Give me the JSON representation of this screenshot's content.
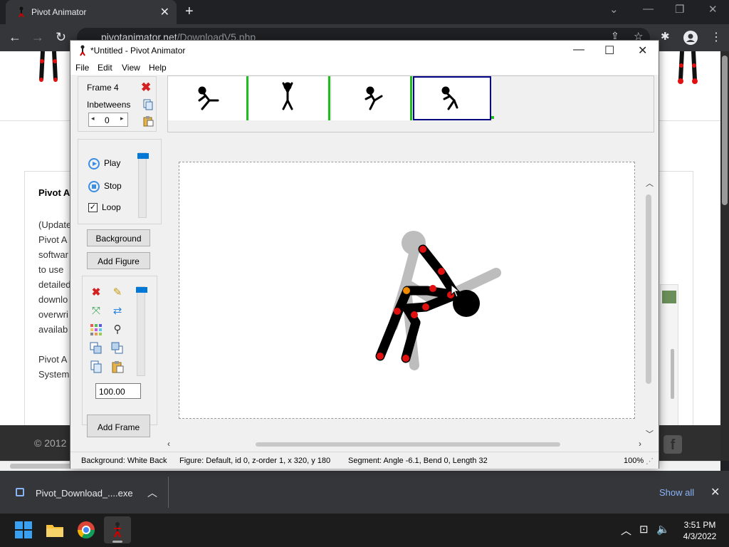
{
  "browser": {
    "tab_title": "Pivot Animator",
    "url_host": "pivotanimator.net",
    "url_path": "/DownloadV5.php",
    "icons": [
      "back-icon",
      "forward-icon",
      "reload-icon",
      "lock-icon",
      "share-icon",
      "star-icon",
      "extensions-icon",
      "profile-icon",
      "menu-icon"
    ]
  },
  "webpage": {
    "heading": "Pivot A",
    "lines": [
      "(Update",
      "Pivot A",
      "softwar",
      "to use",
      "detailed",
      "downlo",
      "overwri",
      "availab"
    ],
    "lines2": [
      "Pivot A",
      "System"
    ],
    "footer": "© 2012"
  },
  "downloads": {
    "file_name": "Pivot_Download_....exe",
    "show_all": "Show all"
  },
  "taskbar": {
    "time": "3:51 PM",
    "date": "4/3/2022"
  },
  "pivot": {
    "title": "*Untitled - Pivot Animator",
    "menu": [
      "File",
      "Edit",
      "View",
      "Help"
    ],
    "frame_label": "Frame 4",
    "inbetweens_label": "Inbetweens",
    "inbetweens_value": "0",
    "play_label": "Play",
    "stop_label": "Stop",
    "loop_label": "Loop",
    "background_button": "Background",
    "add_figure_button": "Add Figure",
    "zoom_value": "100.00",
    "add_frame_button": "Add Frame",
    "status": {
      "background": "Background: White Back",
      "figure": "Figure: Default,  id 0,  z-order 1,  x 320, y 180",
      "segment": "Segment: Angle -6.1,  Bend 0,  Length 32",
      "zoom": "100%"
    }
  },
  "colors": {
    "accent_blue": "#0078d7",
    "frame_select": "#000080",
    "frame_divider": "#22bb22",
    "joint_red": "#e01010",
    "joint_orange": "#f08a00"
  }
}
